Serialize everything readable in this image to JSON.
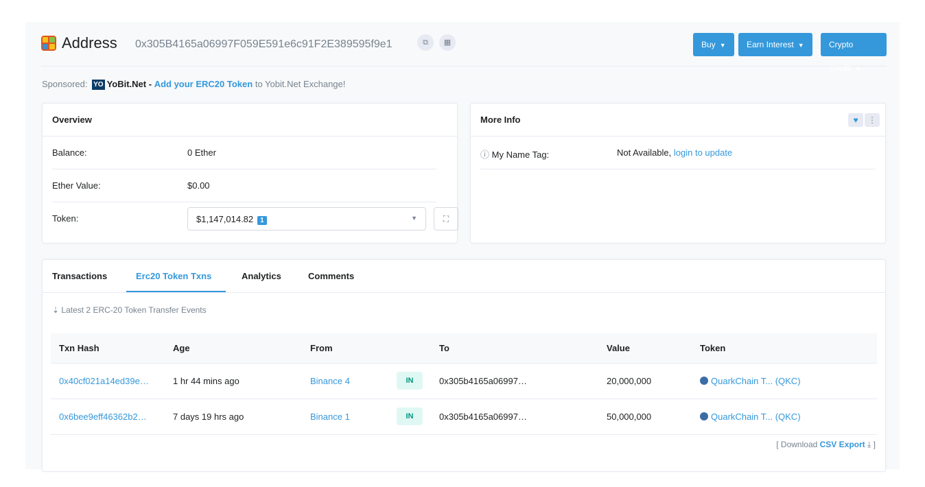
{
  "header": {
    "title": "Address",
    "address": "0x305B4165a06997F059E591e6c91F2E389595f9e1",
    "copy_icon": "copy-icon",
    "qr_icon": "qr-code-icon",
    "buttons": [
      {
        "label": "Buy"
      },
      {
        "label": "Earn Interest"
      },
      {
        "label": "Crypto Credit"
      }
    ]
  },
  "sponsored": {
    "prefix": "Sponsored:",
    "logo": "YO",
    "brand": "YoBit.Net -",
    "link": "Add your ERC20 Token",
    "suffix": "to Yobit.Net Exchange!"
  },
  "overview": {
    "title": "Overview",
    "balance_label": "Balance:",
    "balance_value": "0 Ether",
    "ether_value_label": "Ether Value:",
    "ether_value": "$0.00",
    "token_label": "Token:",
    "token_value": "$1,147,014.82",
    "token_count": "1"
  },
  "more_info": {
    "title": "More Info",
    "name_tag_label": "My Name Tag:",
    "name_tag_value": "Not Available,",
    "login_link": "login to update"
  },
  "tabs": [
    {
      "label": "Transactions"
    },
    {
      "label": "Erc20 Token Txns",
      "active": true
    },
    {
      "label": "Analytics"
    },
    {
      "label": "Comments"
    }
  ],
  "latest_text": "Latest 2 ERC-20 Token Transfer Events",
  "table": {
    "headers": [
      "Txn Hash",
      "Age",
      "From",
      "To",
      "Value",
      "Token"
    ],
    "rows": [
      {
        "hash": "0x40cf021a14ed39e…",
        "age": "1 hr 44 mins ago",
        "from": "Binance 4",
        "direction": "IN",
        "to": "0x305b4165a06997…",
        "value": "20,000,000",
        "token": "QuarkChain T... (QKC)"
      },
      {
        "hash": "0x6bee9eff46362b2…",
        "age": "7 days 19 hrs ago",
        "from": "Binance 1",
        "direction": "IN",
        "to": "0x305b4165a06997…",
        "value": "50,000,000",
        "token": "QuarkChain T... (QKC)"
      }
    ]
  },
  "export": {
    "prefix": "[ Download",
    "link": "CSV Export",
    "suffix": "]"
  },
  "colors": {
    "accent": "#3498db",
    "in_badge": "#02977e"
  }
}
